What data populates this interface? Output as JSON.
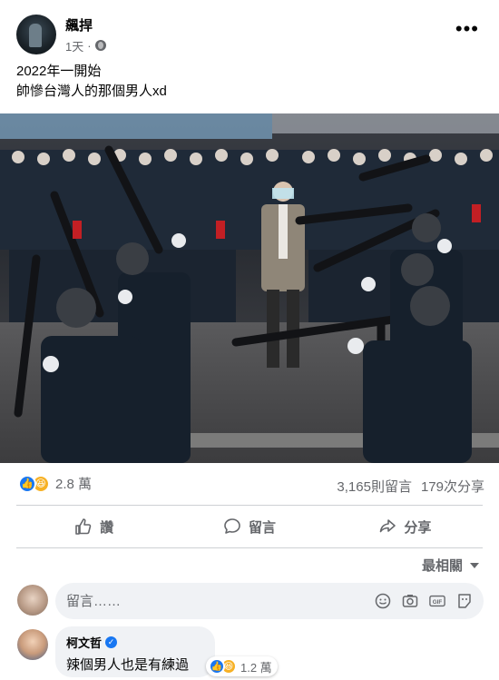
{
  "post": {
    "author": "飆捍",
    "time": "1天",
    "privacy_icon": "globe-icon",
    "more_label": "•••",
    "text_line1": "2022年一開始",
    "text_line2": "帥慘台灣人的那個男人xd"
  },
  "reactions": {
    "icons": [
      "like-icon",
      "haha-icon"
    ],
    "count": "2.8 萬",
    "comments": "3,165則留言",
    "shares": "179次分享"
  },
  "actions": {
    "like": "讚",
    "comment": "留言",
    "share": "分享"
  },
  "sort": {
    "label": "最相關"
  },
  "comment_box": {
    "placeholder": "留言……"
  },
  "top_comment": {
    "author": "柯文哲",
    "verified": true,
    "text": "辣個男人也是有練過",
    "reaction_count": "1.2 萬"
  },
  "colors": {
    "accent": "#1877f2",
    "muted": "#65676b",
    "divider": "#ced0d4",
    "bubble": "#f0f2f5",
    "haha": "#f7b125"
  }
}
